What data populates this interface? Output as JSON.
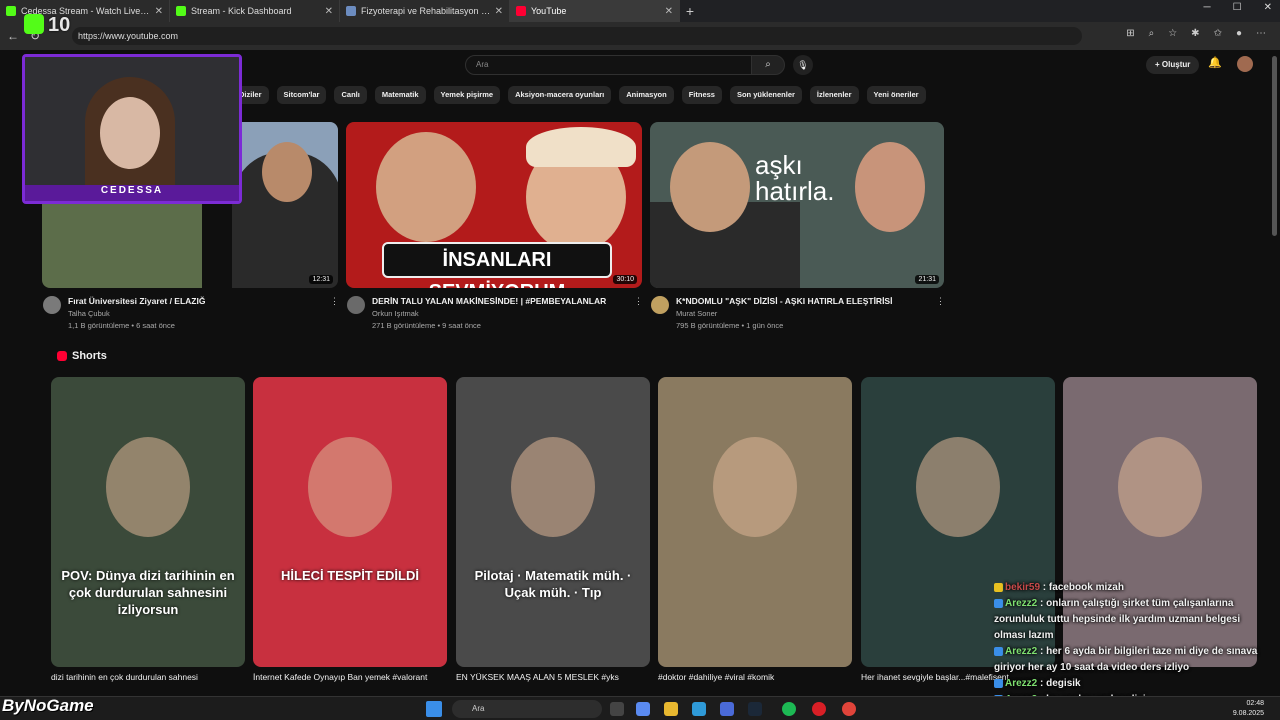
{
  "browser": {
    "tabs": [
      {
        "label": "Cedessa Stream - Watch Live on Kick",
        "color": "#53fc18"
      },
      {
        "label": "Stream - Kick Dashboard",
        "color": "#53fc18"
      },
      {
        "label": "Fizyoterapi ve Rehabilitasyon 2025",
        "color": "#6c8cc0"
      },
      {
        "label": "YouTube",
        "color": "#ff0033"
      }
    ],
    "url": "https://www.youtube.com"
  },
  "overlay": {
    "counter": "10",
    "webcam_label": "CEDESSA"
  },
  "youtube": {
    "search_placeholder": "Ara",
    "create_label": "Oluştur",
    "chips": [
      "Diziler",
      "Sitcom'lar",
      "Canlı",
      "Matematik",
      "Yemek pişirme",
      "Aksiyon-macera oyunları",
      "Animasyon",
      "Fitness",
      "Son yüklenenler",
      "İzlenenler",
      "Yeni öneriler"
    ],
    "videos": [
      {
        "title": "Fırat Üniversitesi Ziyaret / ELAZIĞ",
        "channel": "Talha Çubuk",
        "meta": "1,1 B görüntüleme • 6 saat önce",
        "duration": "12:31",
        "thumb_color": "#6e8a58"
      },
      {
        "title": "DERİN TALU YALAN MAKİNESİNDE! | #PEMBEYALANLAR",
        "channel": "Orkun Işıtmak",
        "meta": "271 B görüntüleme • 9 saat önce",
        "duration": "30:10",
        "thumb_color": "#b31b1b",
        "overlay_text": "İNSANLARI SEVMİYORUM"
      },
      {
        "title": "K*NDOMLU \"AŞK\" DİZİSİ - AŞKI HATIRLA ELEŞTİRİSİ",
        "channel": "Murat Soner",
        "meta": "795 B görüntüleme • 1 gün önce",
        "duration": "21:31",
        "thumb_color": "#4a5a55",
        "overlay_text": "aşkı hatırla."
      }
    ],
    "shorts_heading": "Shorts",
    "shorts": [
      {
        "title": "dizi tarihinin en çok durdurulan sahnesi",
        "caption": "POV: Dünya dizi tarihinin en çok durdurulan sahnesini izliyorsun",
        "color": "#3b4a3a"
      },
      {
        "title": "İnternet Kafede Oynayıp Ban yemek #valorant",
        "caption": "HİLECİ TESPİT EDİLDİ",
        "color": "#c8303f"
      },
      {
        "title": "EN YÜKSEK MAAŞ ALAN 5 MESLEK #yks",
        "caption": "Pilotaj · Matematik müh. · Uçak müh. · Tıp",
        "color": "#4a4a4a"
      },
      {
        "title": "#doktor #dahiliye #viral #komik",
        "caption": "",
        "color": "#8a7a60"
      },
      {
        "title": "Her ihanet sevgiyle başlar...#malefisent",
        "caption": "",
        "color": "#2a3f3c"
      },
      {
        "title": "",
        "caption": "",
        "color": "#7a6a70"
      }
    ]
  },
  "chat": [
    {
      "user": "bekir59",
      "text": "facebook mizah"
    },
    {
      "user": "Arezz2",
      "text": "onların çalıştığı şirket tüm çalışanlarına zorunluluk tuttu hepsinde ilk yardım uzmanı belgesi olması lazım"
    },
    {
      "user": "Arezz2",
      "text": "her 6 ayda bir bilgileri taze mi diye de sınava giriyor her ay 10 saat da video ders izliyo"
    },
    {
      "user": "Arezz2",
      "text": "degisik"
    },
    {
      "user": "Arezz2",
      "text": "he maden muhendisi"
    }
  ],
  "taskbar": {
    "search": "Ara",
    "time": "02:48",
    "date": "9.08.2025",
    "brand": "ByNoGame"
  }
}
